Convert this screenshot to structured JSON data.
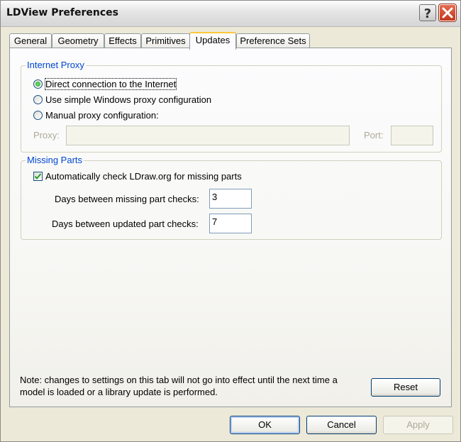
{
  "window": {
    "title": "LDView Preferences"
  },
  "tabs": [
    "General",
    "Geometry",
    "Effects",
    "Primitives",
    "Updates",
    "Preference Sets"
  ],
  "active_tab": "Updates",
  "internet_proxy": {
    "legend": "Internet Proxy",
    "options": [
      {
        "label": "Direct connection to the Internet",
        "selected": true
      },
      {
        "label": "Use simple Windows proxy configuration",
        "selected": false
      },
      {
        "label": "Manual proxy configuration:",
        "selected": false
      }
    ],
    "proxy_label": "Proxy:",
    "proxy_value": "",
    "port_label": "Port:",
    "port_value": ""
  },
  "missing_parts": {
    "legend": "Missing Parts",
    "auto_check_label": "Automatically check LDraw.org for missing parts",
    "auto_check_checked": true,
    "missing_days_label": "Days between missing part checks:",
    "missing_days_value": "3",
    "updated_days_label": "Days between updated part checks:",
    "updated_days_value": "7"
  },
  "note": {
    "line1": "Note: changes to settings on this tab will not go into effect until the next time a",
    "line2": "model is loaded or a library update is performed."
  },
  "buttons": {
    "reset": "Reset",
    "ok": "OK",
    "cancel": "Cancel",
    "apply": "Apply"
  },
  "colors": {
    "legend": "#0046d5",
    "radio_selected": "#21a121",
    "close_button": "#c2371b",
    "face": "#ece9d8"
  },
  "icons": {
    "help": "question-mark-icon",
    "close": "close-x-icon",
    "check": "checkmark-icon"
  }
}
